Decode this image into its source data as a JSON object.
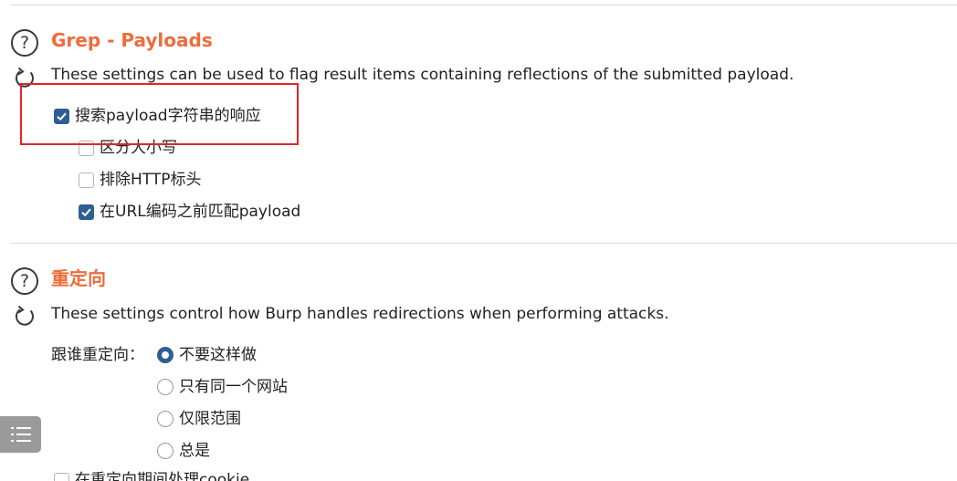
{
  "grep_payloads": {
    "title": "Grep - Payloads",
    "description": "These settings can be used to flag result items containing reflections of the submitted payload.",
    "options": [
      {
        "label": "搜索payload字符串的响应",
        "checked": true
      },
      {
        "label": "区分大小写",
        "checked": false
      },
      {
        "label": "排除HTTP标头",
        "checked": false
      },
      {
        "label": "在URL编码之前匹配payload",
        "checked": true
      }
    ]
  },
  "redirections": {
    "title": "重定向",
    "description": "These settings control how Burp handles redirections when performing attacks.",
    "follow_label": "跟谁重定向：",
    "radio_options": [
      {
        "label": "不要这样做",
        "selected": true
      },
      {
        "label": "只有同一个网站",
        "selected": false
      },
      {
        "label": "仅限范围",
        "selected": false
      },
      {
        "label": "总是",
        "selected": false
      }
    ],
    "cookie_option": {
      "label": "在重定向期间处理cookie",
      "checked": false
    }
  },
  "icons": {
    "help": "help-circle-icon",
    "refresh": "refresh-icon",
    "menu": "list-menu-icon"
  },
  "colors": {
    "title": "#ef6c3b",
    "accent": "#2c5f94",
    "highlight": "#e0252b"
  }
}
